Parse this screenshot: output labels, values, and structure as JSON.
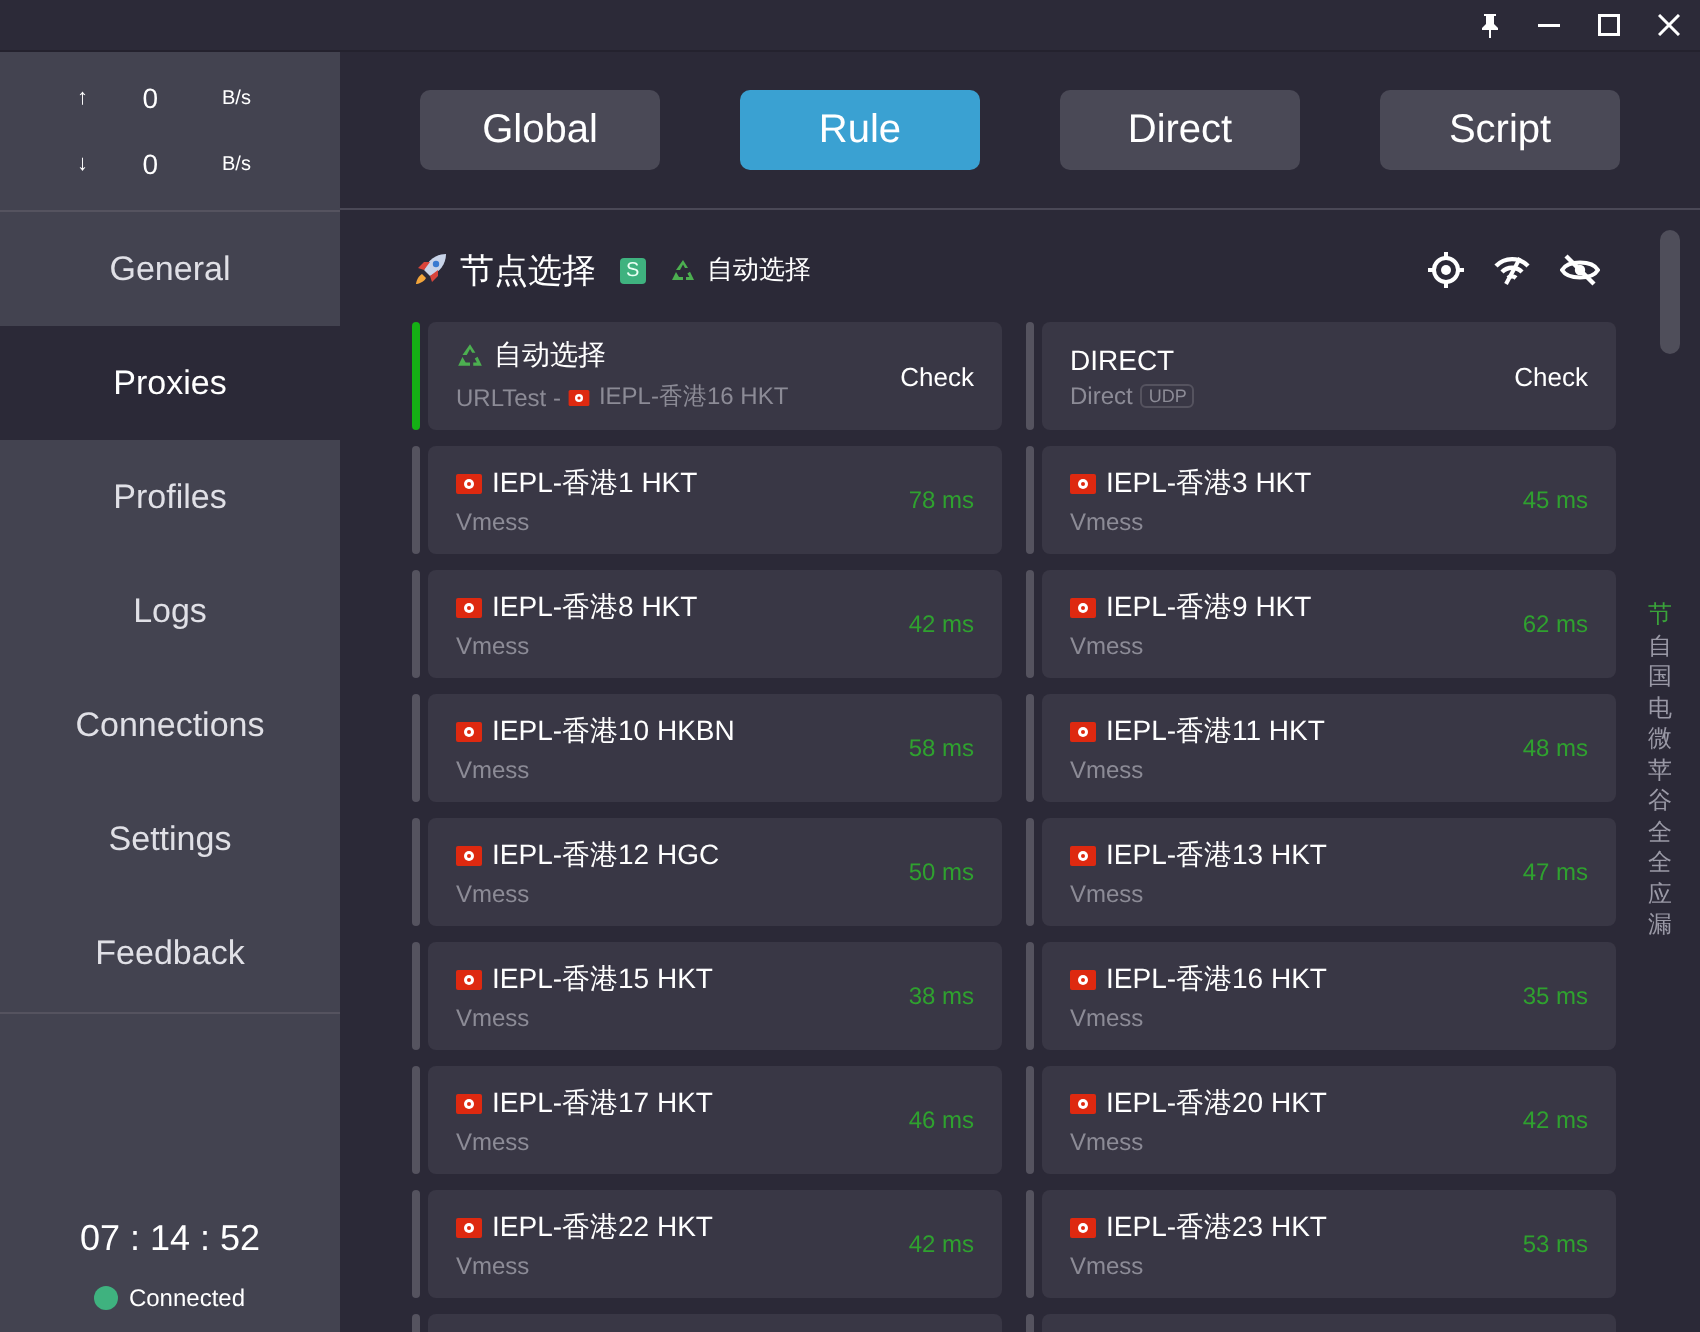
{
  "traffic": [
    {
      "arrow": "↑",
      "value": "0",
      "unit": "B/s"
    },
    {
      "arrow": "↓",
      "value": "0",
      "unit": "B/s"
    }
  ],
  "nav": [
    {
      "label": "General",
      "selected": false
    },
    {
      "label": "Proxies",
      "selected": true
    },
    {
      "label": "Profiles",
      "selected": false
    },
    {
      "label": "Logs",
      "selected": false
    },
    {
      "label": "Connections",
      "selected": false
    },
    {
      "label": "Settings",
      "selected": false
    },
    {
      "label": "Feedback",
      "selected": false
    }
  ],
  "clock": "07 : 14 : 52",
  "status": {
    "label": "Connected",
    "connected": true
  },
  "modes": [
    {
      "label": "Global",
      "selected": false
    },
    {
      "label": "Rule",
      "selected": true
    },
    {
      "label": "Direct",
      "selected": false
    },
    {
      "label": "Script",
      "selected": false
    }
  ],
  "group": {
    "name": "节点选择",
    "type_badge": "S",
    "current": "自动选择"
  },
  "proxies": [
    {
      "kind": "group",
      "name": "自动选择",
      "type": "URLTest - ",
      "now": "IEPL-香港16 HKT",
      "action": "Check",
      "selected": true
    },
    {
      "kind": "direct",
      "name": "DIRECT",
      "type": "Direct",
      "udp": "UDP",
      "action": "Check",
      "selected": false
    },
    {
      "kind": "node",
      "name": "IEPL-香港1 HKT",
      "type": "Vmess",
      "delay": "78 ms",
      "selected": false
    },
    {
      "kind": "node",
      "name": "IEPL-香港3 HKT",
      "type": "Vmess",
      "delay": "45 ms",
      "selected": false
    },
    {
      "kind": "node",
      "name": "IEPL-香港8 HKT",
      "type": "Vmess",
      "delay": "42 ms",
      "selected": false
    },
    {
      "kind": "node",
      "name": "IEPL-香港9 HKT",
      "type": "Vmess",
      "delay": "62 ms",
      "selected": false
    },
    {
      "kind": "node",
      "name": "IEPL-香港10 HKBN",
      "type": "Vmess",
      "delay": "58 ms",
      "selected": false
    },
    {
      "kind": "node",
      "name": "IEPL-香港11 HKT",
      "type": "Vmess",
      "delay": "48 ms",
      "selected": false
    },
    {
      "kind": "node",
      "name": "IEPL-香港12 HGC",
      "type": "Vmess",
      "delay": "50 ms",
      "selected": false
    },
    {
      "kind": "node",
      "name": "IEPL-香港13 HKT",
      "type": "Vmess",
      "delay": "47 ms",
      "selected": false
    },
    {
      "kind": "node",
      "name": "IEPL-香港15 HKT",
      "type": "Vmess",
      "delay": "38 ms",
      "selected": false
    },
    {
      "kind": "node",
      "name": "IEPL-香港16 HKT",
      "type": "Vmess",
      "delay": "35 ms",
      "selected": false
    },
    {
      "kind": "node",
      "name": "IEPL-香港17 HKT",
      "type": "Vmess",
      "delay": "46 ms",
      "selected": false
    },
    {
      "kind": "node",
      "name": "IEPL-香港20 HKT",
      "type": "Vmess",
      "delay": "42 ms",
      "selected": false
    },
    {
      "kind": "node",
      "name": "IEPL-香港22 HKT",
      "type": "Vmess",
      "delay": "42 ms",
      "selected": false
    },
    {
      "kind": "node",
      "name": "IEPL-香港23 HKT",
      "type": "Vmess",
      "delay": "53 ms",
      "selected": false
    }
  ],
  "index": [
    {
      "char": "节",
      "selected": true
    },
    {
      "char": "自",
      "selected": false
    },
    {
      "char": "国",
      "selected": false
    },
    {
      "char": "电",
      "selected": false
    },
    {
      "char": "微",
      "selected": false
    },
    {
      "char": "苹",
      "selected": false
    },
    {
      "char": "谷",
      "selected": false
    },
    {
      "char": "全",
      "selected": false
    },
    {
      "char": "全",
      "selected": false
    },
    {
      "char": "应",
      "selected": false
    },
    {
      "char": "漏",
      "selected": false
    }
  ]
}
